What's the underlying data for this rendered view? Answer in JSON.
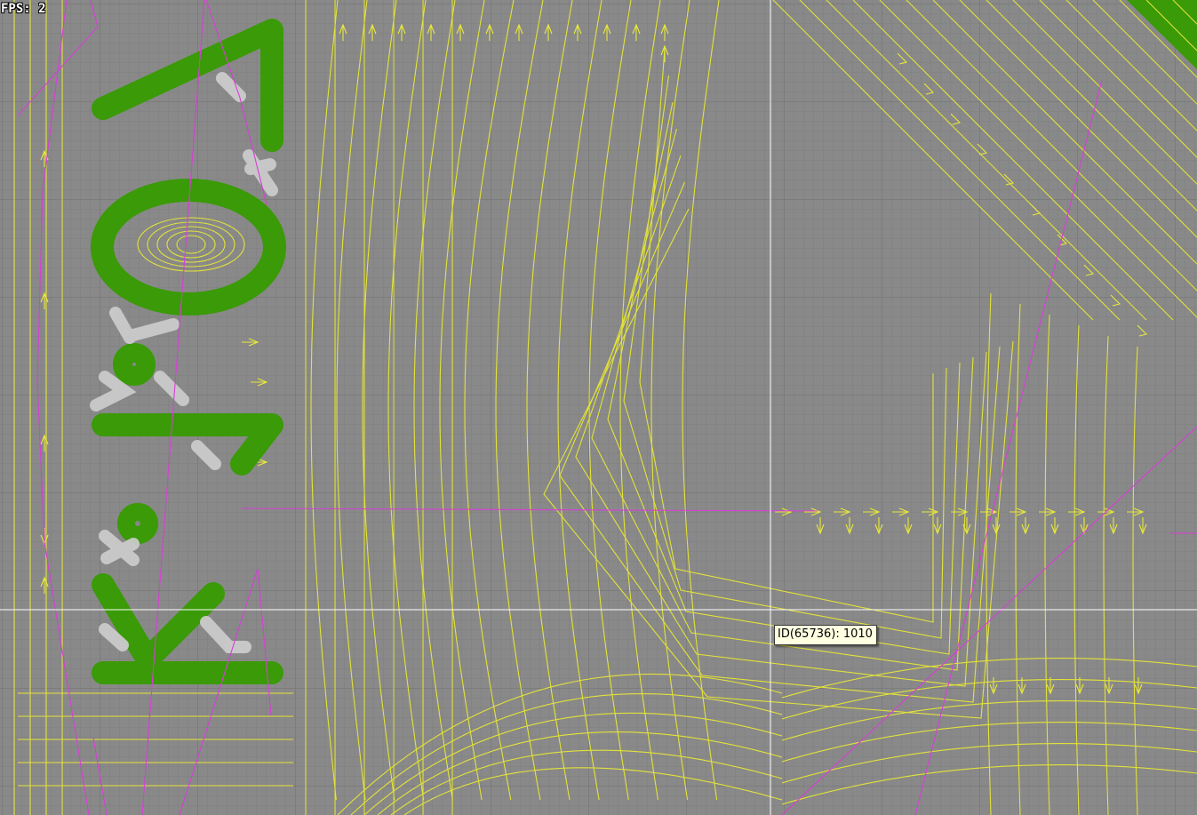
{
  "hud": {
    "fps_label": "FPS: 2"
  },
  "tooltip": {
    "text": "ID(65736): 1010"
  },
  "colors": {
    "background": "#898989",
    "grid_minor": "#7f7f7f",
    "grid_major": "#6f6f6f",
    "toolpath": "#e6e632",
    "rapid_move": "#d63fd6",
    "material": "#3a9a07",
    "keepout": "#cfcfcf",
    "crosshair": "#ffffff"
  },
  "icons": {
    "crosshair": "crosshair-icon"
  }
}
